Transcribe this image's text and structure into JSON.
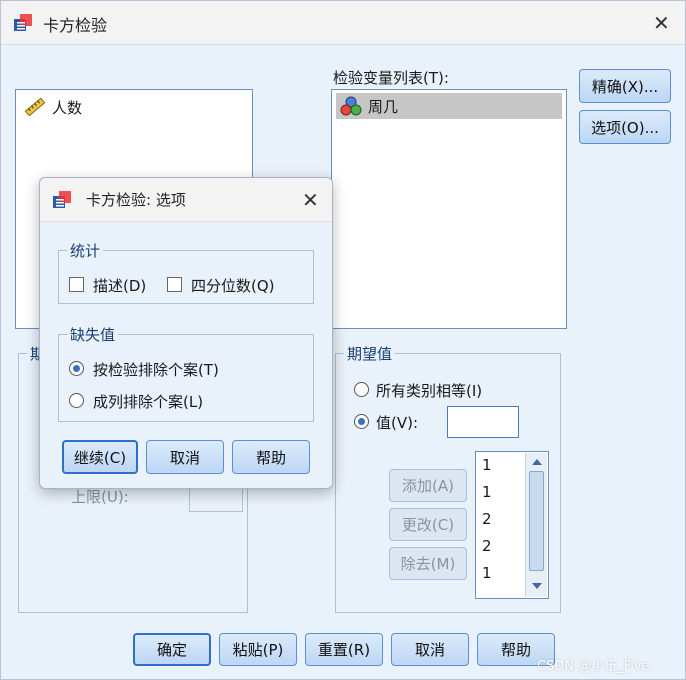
{
  "window": {
    "title": "卡方检验",
    "close_glyph": "✕"
  },
  "left_list": {
    "items": [
      {
        "label": "人数",
        "icon": "ruler-scale-icon"
      }
    ]
  },
  "test_variables": {
    "label": "检验变量列表(T):",
    "items": [
      {
        "label": "周几",
        "icon": "nominal-circles-icon",
        "selected": true
      }
    ]
  },
  "right_buttons": {
    "exact": "精确(X)...",
    "options": "选项(O)..."
  },
  "expected_range": {
    "title": "期",
    "upper_label": "上限(U):"
  },
  "expected_values": {
    "title": "期望值",
    "all_equal": "所有类别相等(I)",
    "values_label": "值(V):",
    "value_input": "",
    "add": "添加(A)",
    "change": "更改(C)",
    "remove": "除去(M)",
    "list": [
      "1",
      "1",
      "2",
      "2",
      "1"
    ]
  },
  "bottom_buttons": {
    "ok": "确定",
    "paste": "粘贴(P)",
    "reset": "重置(R)",
    "cancel": "取消",
    "help": "帮助"
  },
  "options_dialog": {
    "title": "卡方检验: 选项",
    "close_glyph": "✕",
    "statistics": {
      "title": "统计",
      "descriptives": "描述(D)",
      "quartiles": "四分位数(Q)"
    },
    "missing": {
      "title": "缺失值",
      "exclude_test": "按检验排除个案(T)",
      "exclude_listwise": "成列排除个案(L)"
    },
    "buttons": {
      "continue": "继续(C)",
      "cancel": "取消",
      "help": "帮助"
    }
  },
  "watermark": "CSDN @小伍_Five"
}
